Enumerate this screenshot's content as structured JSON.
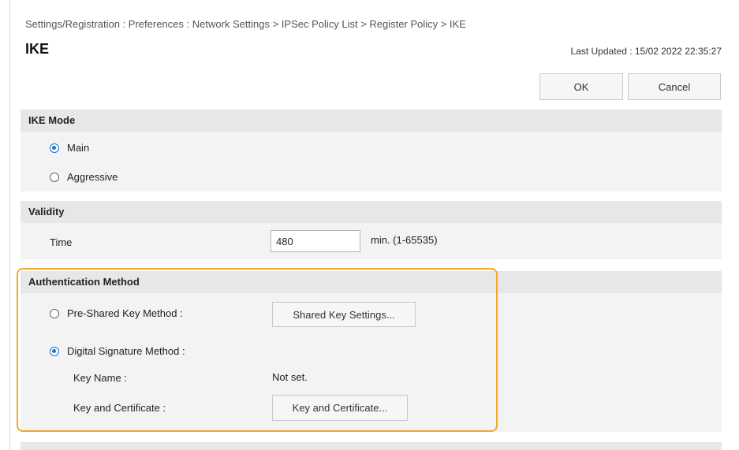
{
  "breadcrumb": "Settings/Registration : Preferences : Network Settings > IPSec Policy List > Register Policy > IKE",
  "page_title": "IKE",
  "last_updated": "Last Updated : 15/02 2022 22:35:27",
  "buttons": {
    "ok": "OK",
    "cancel": "Cancel"
  },
  "ike_mode": {
    "header": "IKE Mode",
    "options": [
      {
        "label": "Main",
        "selected": true
      },
      {
        "label": "Aggressive",
        "selected": false
      }
    ]
  },
  "validity": {
    "header": "Validity",
    "time_label": "Time",
    "time_value": "480",
    "time_unit": "min. (1-65535)"
  },
  "auth_method": {
    "header": "Authentication Method",
    "pre_shared_label": "Pre-Shared Key Method :",
    "pre_shared_selected": false,
    "shared_key_button": "Shared Key Settings...",
    "digital_sig_label": "Digital Signature Method :",
    "digital_sig_selected": true,
    "key_name_label": "Key Name :",
    "key_name_value": "Not set.",
    "key_cert_label": "Key and Certificate :",
    "key_cert_button": "Key and Certificate..."
  },
  "colors": {
    "highlight": "#f0a830",
    "radio_selected": "#1a6fd3",
    "section_header": "#e7e7e7"
  }
}
